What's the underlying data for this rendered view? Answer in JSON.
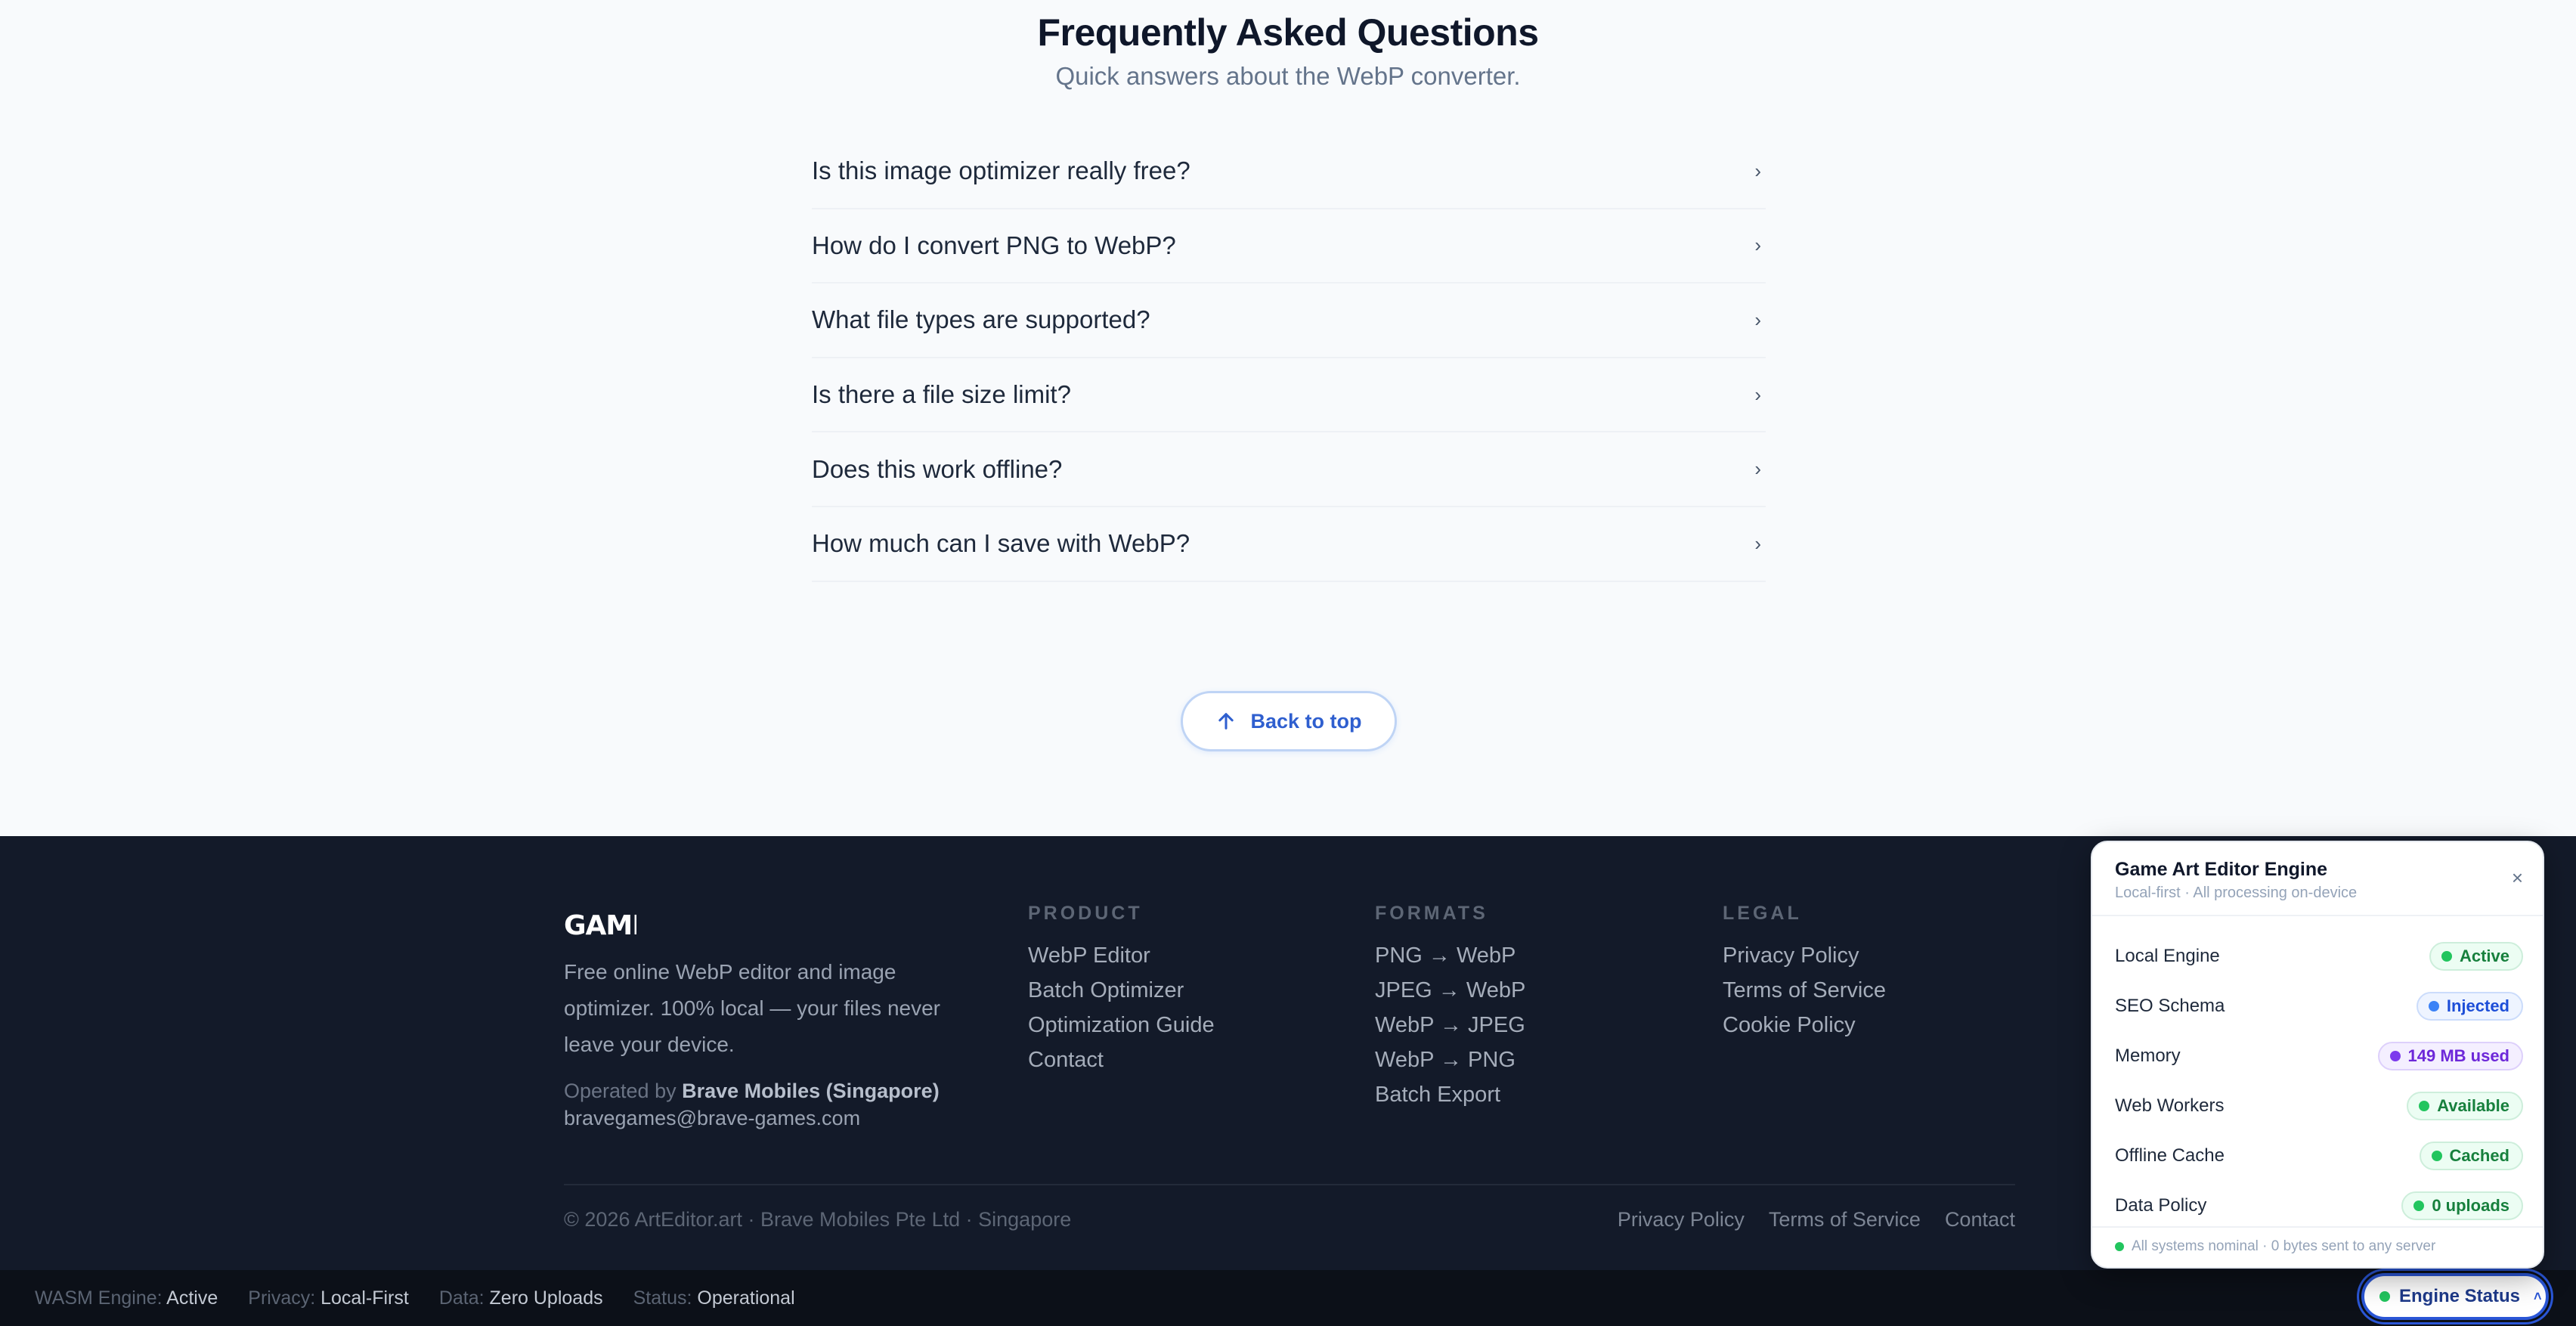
{
  "faq": {
    "title": "Frequently Asked Questions",
    "subtitle": "Quick answers about the WebP converter.",
    "items": [
      {
        "question": "Is this image optimizer really free?"
      },
      {
        "question": "How do I convert PNG to WebP?"
      },
      {
        "question": "What file types are supported?"
      },
      {
        "question": "Is there a file size limit?"
      },
      {
        "question": "Does this work offline?"
      },
      {
        "question": "How much can I save with WebP?"
      }
    ],
    "chevron": "›",
    "back_to_top": "Back to top"
  },
  "footer": {
    "logo_text": "GAMI",
    "tagline": "Free online WebP editor and image optimizer. 100% local — your files never leave your device.",
    "operated_prefix": "Operated by",
    "operator": "Brave Mobiles (Singapore)",
    "email": "bravegames@brave-games.com",
    "columns": {
      "product": {
        "heading": "PRODUCT",
        "links": [
          "WebP Editor",
          "Batch Optimizer",
          "Optimization Guide",
          "Contact"
        ]
      },
      "formats": {
        "heading": "FORMATS",
        "links": [
          "PNG → WebP",
          "JPEG → WebP",
          "WebP → JPEG",
          "WebP → PNG",
          "Batch Export"
        ]
      },
      "legal": {
        "heading": "LEGAL",
        "links": [
          "Privacy Policy",
          "Terms of Service",
          "Cookie Policy"
        ]
      }
    },
    "copyright": "© 2026 ArtEditor.art · Brave Mobiles Pte Ltd · Singapore",
    "bottom_links": [
      "Privacy Policy",
      "Terms of Service",
      "Contact"
    ]
  },
  "status_bar": {
    "items": [
      {
        "label": "WASM Engine:",
        "value": "Active"
      },
      {
        "label": "Privacy:",
        "value": "Local-First"
      },
      {
        "label": "Data:",
        "value": "Zero Uploads"
      },
      {
        "label": "Status:",
        "value": "Operational"
      }
    ],
    "engine_button": "Engine Status",
    "engine_button_chevron": "˄"
  },
  "engine_panel": {
    "title": "Game Art Editor Engine",
    "subtitle": "Local-first · All processing on-device",
    "close": "×",
    "rows": [
      {
        "label": "Local Engine",
        "value": "Active",
        "color": "green"
      },
      {
        "label": "SEO Schema",
        "value": "Injected",
        "color": "blue"
      },
      {
        "label": "Memory",
        "value": "149 MB used",
        "color": "purple"
      },
      {
        "label": "Web Workers",
        "value": "Available",
        "color": "green"
      },
      {
        "label": "Offline Cache",
        "value": "Cached",
        "color": "green"
      },
      {
        "label": "Data Policy",
        "value": "0 uploads",
        "color": "green"
      }
    ],
    "footer": "All systems nominal · 0 bytes sent to any server"
  },
  "colors": {
    "accent": "#2a56d6",
    "footer_bg": "#131a29",
    "status_green": "#22c55e"
  }
}
